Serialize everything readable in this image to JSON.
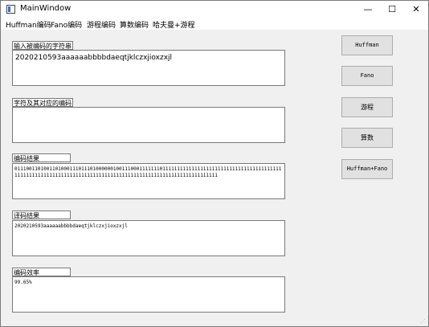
{
  "window": {
    "title": "MainWindow",
    "controls": {
      "minimize": "—",
      "maximize": "☐",
      "close": "✕"
    }
  },
  "menu": [
    "Huffman编码",
    "Fano编码",
    "游程编码",
    "算数编码",
    "哈夫曼+游程"
  ],
  "input": {
    "label": "输入被编码的字符串",
    "value": "2020210593aaaaaabbbbdaeqtjklczxjioxzxjl"
  },
  "codes": {
    "label": "字符及其对应的编码",
    "value": ""
  },
  "encode_result": {
    "label": "编码结果",
    "value": "011100110100110100011101110100000010011100011111110111111111111111111111111111111111111111111111111111111111111111111111111111111111111111111111111111111111111111"
  },
  "decode_result": {
    "label": "译码结果",
    "value": "2020210593aaaaaabbbbdaeqtjklczxjioxzxjl"
  },
  "efficiency": {
    "label": "编码效率",
    "value": "99.65%"
  },
  "buttons": {
    "huffman": "Huffman",
    "fano": "Fano",
    "runlength": "游程",
    "arithmetic": "算数",
    "huffman_fano": "Huffman+Fano"
  }
}
